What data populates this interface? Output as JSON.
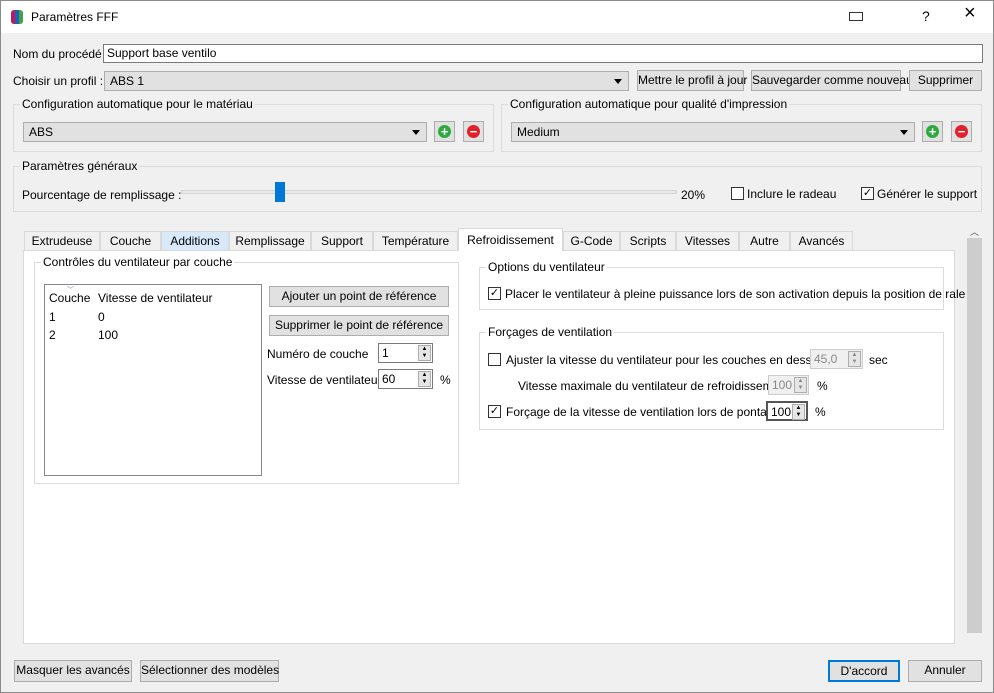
{
  "window": {
    "title": "Paramètres FFF",
    "help": "?",
    "close": "×"
  },
  "process": {
    "label": "Nom du procédé :",
    "value": "Support base ventilo"
  },
  "profile": {
    "label": "Choisir un profil :",
    "value": "ABS 1",
    "update": "Mettre le profil à jour",
    "save_new": "Sauvegarder comme nouveau",
    "delete": "Supprimer"
  },
  "material": {
    "title": "Configuration automatique pour le matériau",
    "value": "ABS"
  },
  "quality": {
    "title": "Configuration automatique pour qualité d'impression",
    "value": "Medium"
  },
  "general": {
    "title": "Paramètres généraux",
    "infill_label": "Pourcentage de remplissage :",
    "infill_value": "20%",
    "infill_percent": 20,
    "raft_label": "Inclure le radeau",
    "raft_checked": false,
    "support_label": "Générer le support",
    "support_checked": true
  },
  "tabs": [
    "Extrudeuse",
    "Couche",
    "Additions",
    "Remplissage",
    "Support",
    "Température",
    "Refroidissement",
    "G-Code",
    "Scripts",
    "Vitesses",
    "Autre",
    "Avancés"
  ],
  "active_tab": "Refroidissement",
  "fan_layers": {
    "title": "Contrôles du ventilateur par couche",
    "headers": [
      "Couche",
      "Vitesse de ventilateur"
    ],
    "rows": [
      [
        "1",
        "0"
      ],
      [
        "2",
        "100"
      ]
    ],
    "add": "Ajouter un point de référence",
    "remove": "Supprimer le point de référence",
    "layer_label": "Numéro de couche",
    "layer_value": "1",
    "speed_label": "Vitesse de ventilateur",
    "speed_value": "60",
    "unit": "%"
  },
  "fan_options": {
    "title": "Options du ventilateur",
    "full_power_label": "Placer le ventilateur à pleine puissance lors de son activation depuis la position de ralenti",
    "full_power_checked": true
  },
  "overrides": {
    "title": "Forçages de ventilation",
    "adjust_label": "Ajuster la vitesse du ventilateur pour les couches en dessous",
    "adjust_checked": false,
    "adjust_value": "45,0",
    "adjust_unit": "sec",
    "max_label": "Vitesse maximale du ventilateur de refroidissement",
    "max_value": "100",
    "max_unit": "%",
    "bridge_label": "Forçage de la vitesse de ventilation lors de pontage",
    "bridge_checked": true,
    "bridge_value": "100",
    "bridge_unit": "%"
  },
  "footer": {
    "hide_advanced": "Masquer les avancés",
    "select_models": "Sélectionner des modèles",
    "ok": "D'accord",
    "cancel": "Annuler"
  }
}
